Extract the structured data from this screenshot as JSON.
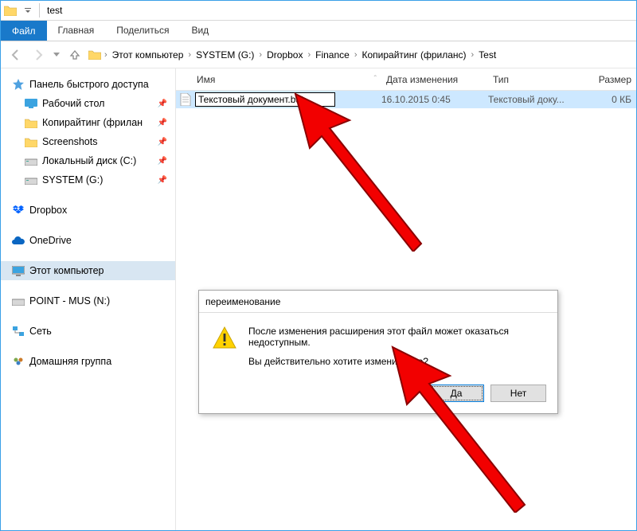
{
  "titlebar": {
    "title": "test"
  },
  "ribbon": {
    "file": "Файл",
    "home": "Главная",
    "share": "Поделиться",
    "view": "Вид"
  },
  "breadcrumbs": {
    "c0": "Этот компьютер",
    "c1": "SYSTEM (G:)",
    "c2": "Dropbox",
    "c3": "Finance",
    "c4": "Копирайтинг (фриланс)",
    "c5": "Test"
  },
  "sidebar": {
    "quick_access": "Панель быстрого доступа",
    "desktop": "Рабочий стол",
    "copywriting": "Копирайтинг (фрилан",
    "screenshots": "Screenshots",
    "local_disk_c": "Локальный диск (C:)",
    "system_g": "SYSTEM (G:)",
    "dropbox": "Dropbox",
    "onedrive": "OneDrive",
    "this_pc": "Этот компьютер",
    "point_mus": "POINT - MUS (N:)",
    "network": "Сеть",
    "homegroup": "Домашняя группа"
  },
  "columns": {
    "name": "Имя",
    "date": "Дата изменения",
    "type": "Тип",
    "size": "Размер"
  },
  "file": {
    "rename_value": "Текстовый документ.bat",
    "date": "16.10.2015 0:45",
    "type": "Текстовый доку...",
    "size": "0 КБ"
  },
  "dialog": {
    "title": "переименование",
    "line1": "После изменения расширения этот файл может оказаться недоступным.",
    "line2": "Вы действительно хотите изменить его?",
    "yes": "Да",
    "no": "Нет"
  }
}
